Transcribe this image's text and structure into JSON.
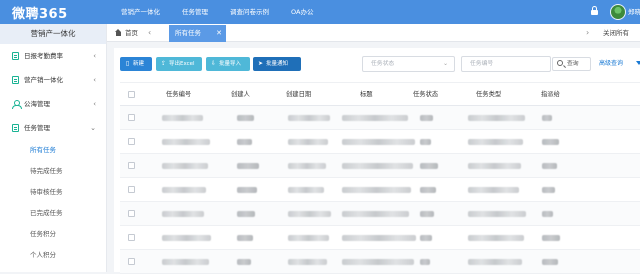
{
  "app": {
    "logo": "微聘365",
    "username": "郑晓星"
  },
  "topnav": [
    "营销产一体化",
    "任务管理",
    "调查问卷示例",
    "OA办公"
  ],
  "sidebar": {
    "title": "营销产一体化",
    "groups": [
      {
        "label": "日报考勤费率",
        "icon": "document-icon"
      },
      {
        "label": "营产销一体化",
        "icon": "document-icon"
      },
      {
        "label": "公海管理",
        "icon": "user-icon"
      },
      {
        "label": "任务管理",
        "icon": "document-icon",
        "expanded": true
      }
    ],
    "subitems": [
      "所有任务",
      "待完成任务",
      "待审核任务",
      "已完成任务",
      "任务积分",
      "个人积分"
    ],
    "active_subitem": "所有任务"
  },
  "tabs": {
    "home": "首页",
    "active": "所有任务",
    "close_all": "关闭所有"
  },
  "toolbar": {
    "new_label": "新建",
    "export_label": "导出Excel",
    "import_label": "批量导入",
    "notify_label": "批量通知"
  },
  "filters": {
    "status_placeholder": "任务状态",
    "task_no_placeholder": "任务编号",
    "search_label": "查询",
    "advanced_label": "高级查询"
  },
  "table": {
    "columns": [
      "任务编号",
      "创建人",
      "创建日期",
      "标题",
      "任务状态",
      "任务类型",
      "指派给"
    ],
    "row_count": 7,
    "rows_note": "cell contents are blurred/obscured in the screenshot"
  },
  "colors": {
    "topbar": "#4a8fe0",
    "accent": "#1a7ad4",
    "active_tab": "#5b9ae6",
    "btn_new": "#2b84d6",
    "btn_light": "#4fb8d8",
    "btn_dark": "#1f6fb8",
    "sidebar_icon": "#1ab394"
  }
}
